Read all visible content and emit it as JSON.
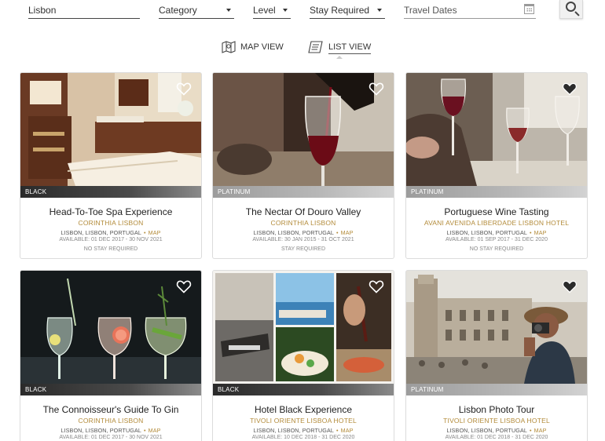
{
  "filters": {
    "location_value": "Lisbon",
    "category_label": "Category",
    "level_label": "Level",
    "stay_label": "Stay Required",
    "dates_placeholder": "Travel Dates"
  },
  "view_toggle": {
    "map_label": "MAP VIEW",
    "list_label": "LIST VIEW"
  },
  "cards": [
    {
      "tier": "BLACK",
      "title": "Head-To-Toe Spa Experience",
      "hotel": "CORINTHIA LISBON",
      "location": "LISBON, LISBON, PORTUGAL",
      "map_label": "MAP",
      "availability": "AVAILABLE: 01 DEC 2017 - 30 NOV 2021",
      "stay": "NO STAY REQUIRED"
    },
    {
      "tier": "PLATINUM",
      "title": "The Nectar Of Douro Valley",
      "hotel": "CORINTHIA LISBON",
      "location": "LISBON, LISBON, PORTUGAL",
      "map_label": "MAP",
      "availability": "AVAILABLE: 30 JAN 2015 - 31 OCT 2021",
      "stay": "STAY REQUIRED"
    },
    {
      "tier": "PLATINUM",
      "title": "Portuguese Wine Tasting",
      "hotel": "AVANI AVENIDA LIBERDADE LISBON HOTEL",
      "location": "LISBON, LISBON, PORTUGAL",
      "map_label": "MAP",
      "availability": "AVAILABLE: 01 SEP 2017 - 31 DEC 2020",
      "stay": "NO STAY REQUIRED"
    },
    {
      "tier": "BLACK",
      "title": "The Connoisseur's Guide To Gin",
      "hotel": "CORINTHIA LISBON",
      "location": "LISBON, LISBON, PORTUGAL",
      "map_label": "MAP",
      "availability": "AVAILABLE: 01 DEC 2017 - 30 NOV 2021",
      "stay": ""
    },
    {
      "tier": "BLACK",
      "title": "Hotel Black Experience",
      "hotel": "TIVOLI ORIENTE LISBOA HOTEL",
      "location": "LISBON, LISBON, PORTUGAL",
      "map_label": "MAP",
      "availability": "AVAILABLE: 10 DEC 2018 - 31 DEC 2020",
      "stay": ""
    },
    {
      "tier": "PLATINUM",
      "title": "Lisbon Photo Tour",
      "hotel": "TIVOLI ORIENTE LISBOA HOTEL",
      "location": "LISBON, LISBON, PORTUGAL",
      "map_label": "MAP",
      "availability": "AVAILABLE: 01 DEC 2018 - 31 DEC 2020",
      "stay": ""
    }
  ],
  "colors": {
    "accent_gold": "#b38b3a",
    "tier_black": "#3a3a3a",
    "tier_platinum": "#b5b5b5"
  }
}
